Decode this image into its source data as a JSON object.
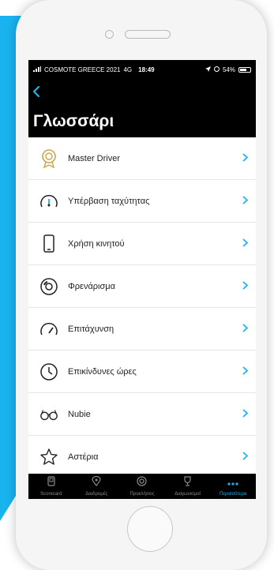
{
  "status": {
    "carrier": "COSMOTE GREECE 2021",
    "network": "4G",
    "time": "18:49",
    "battery": "54%"
  },
  "header": {
    "title": "Γλωσσάρι"
  },
  "list": {
    "items": [
      {
        "label": "Master Driver",
        "icon": "master-driver-badge-icon"
      },
      {
        "label": "Υπέρβαση ταχύτητας",
        "icon": "speedometer-icon"
      },
      {
        "label": "Χρήση κινητού",
        "icon": "phone-icon"
      },
      {
        "label": "Φρενάρισμα",
        "icon": "brake-icon"
      },
      {
        "label": "Επιτάχυνση",
        "icon": "acceleration-gauge-icon"
      },
      {
        "label": "Επικίνδυνες ώρες",
        "icon": "clock-icon"
      },
      {
        "label": "Nubie",
        "icon": "glasses-icon"
      },
      {
        "label": "Αστέρια",
        "icon": "star-icon"
      }
    ]
  },
  "tabbar": {
    "tabs": [
      {
        "label": "Scorecard",
        "icon": "scorecard-icon"
      },
      {
        "label": "Διαδρομές",
        "icon": "location-pin-icon"
      },
      {
        "label": "Προκλήσεις",
        "icon": "target-icon"
      },
      {
        "label": "Διαγωνισμοί",
        "icon": "trophy-icon"
      },
      {
        "label": "Περισσότερα",
        "icon": "more-dots-icon",
        "active": true
      }
    ]
  },
  "colors": {
    "accent": "#19b4f0",
    "header_bg": "#000000",
    "icon_gold": "#c9a44a"
  }
}
